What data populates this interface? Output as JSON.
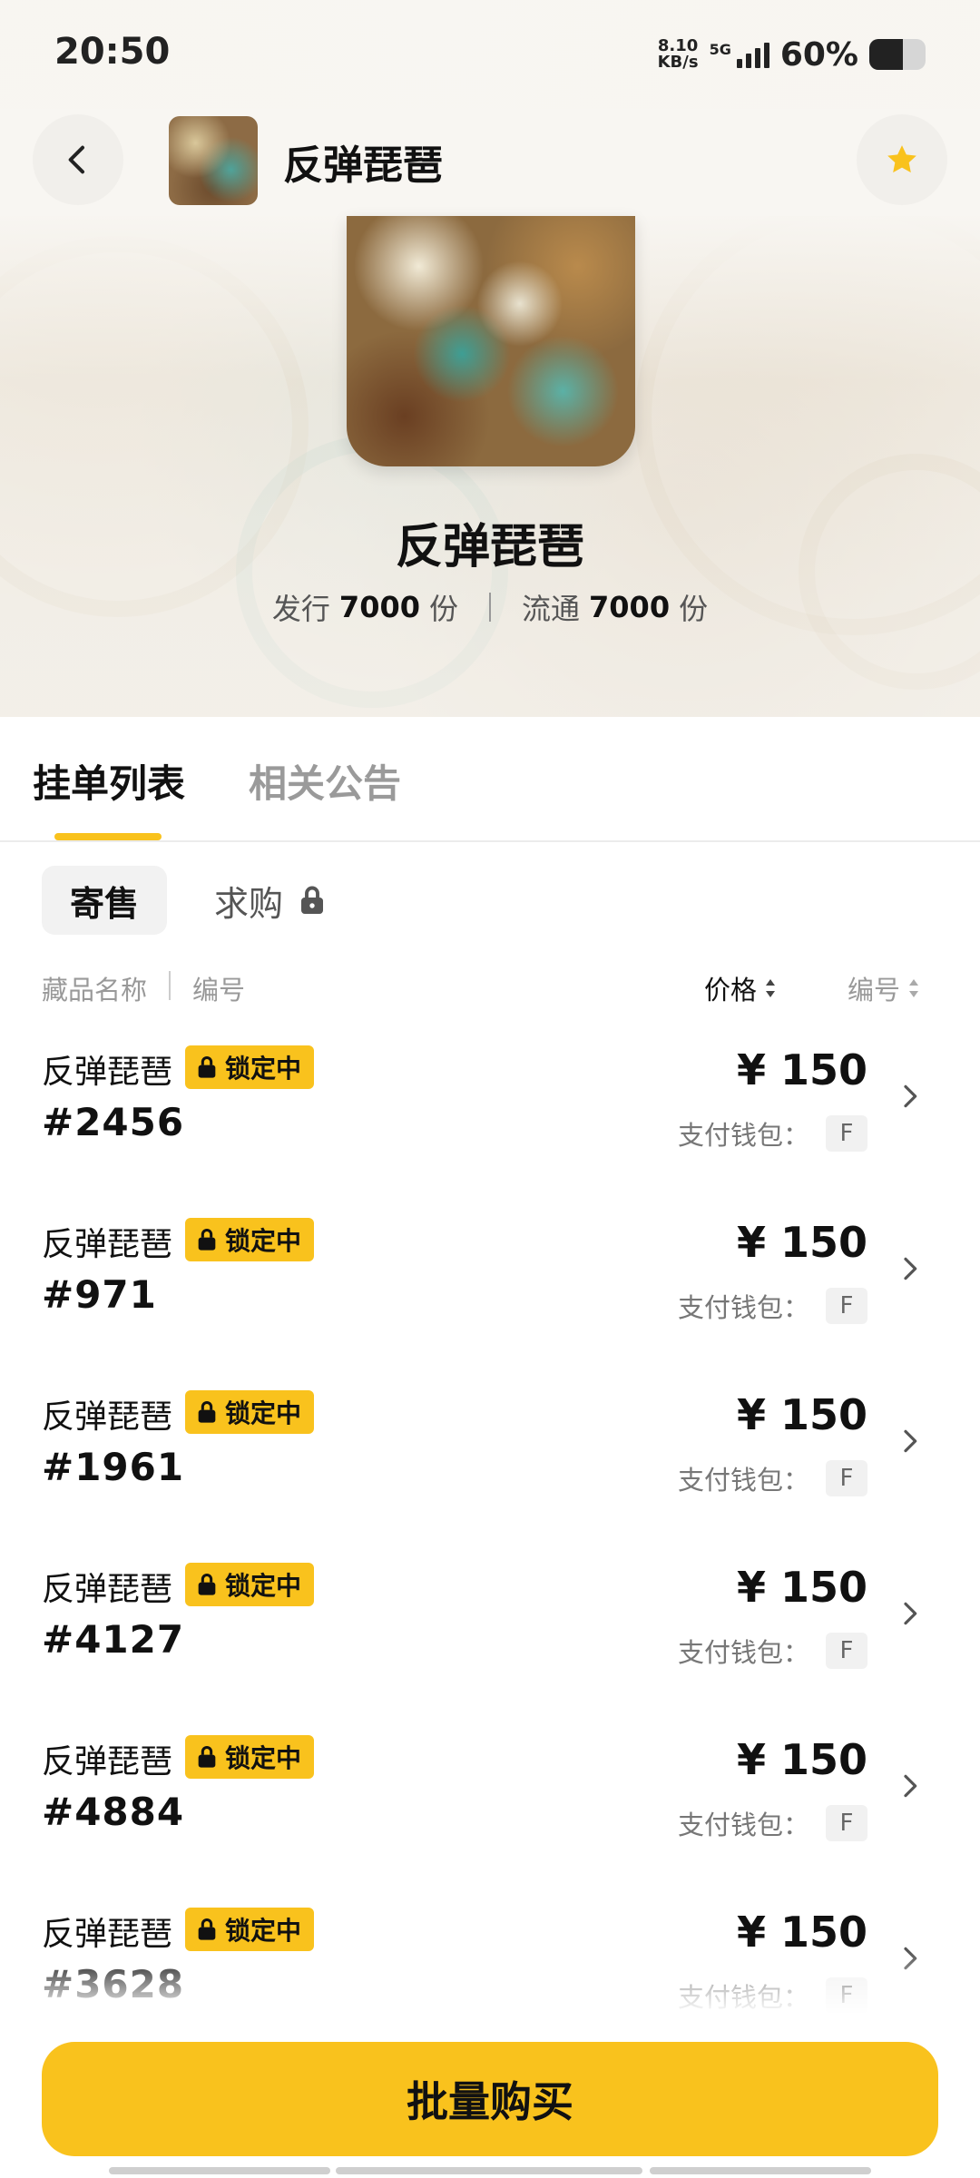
{
  "status_bar": {
    "time": "20:50",
    "net_speed_value": "8.10",
    "net_speed_unit": "KB/s",
    "network": "5G",
    "battery_percent": "60%",
    "battery_level": 0.6
  },
  "header": {
    "title": "反弹琵琶",
    "back_icon": "chevron-left-icon",
    "favorite_icon": "star-icon",
    "favorite_color": "#f9c21d"
  },
  "collection": {
    "title": "反弹琵琶",
    "issued_label": "发行",
    "issued_value": "7000",
    "issued_unit": "份",
    "circulating_label": "流通",
    "circulating_value": "7000",
    "circulating_unit": "份"
  },
  "tabs": {
    "listings": "挂单列表",
    "announcements": "相关公告"
  },
  "subtabs": {
    "sell": "寄售",
    "buy": "求购",
    "buy_icon": "lock-icon"
  },
  "columns": {
    "name": "藏品名称",
    "number": "编号",
    "price": "价格",
    "sort_number": "编号"
  },
  "lock_label": "锁定中",
  "wallet_label": "支付钱包：",
  "items": [
    {
      "name": "反弹琵琶",
      "number": "#2456",
      "price": "¥ 150",
      "wallet": "F"
    },
    {
      "name": "反弹琵琶",
      "number": "#971",
      "price": "¥ 150",
      "wallet": "F"
    },
    {
      "name": "反弹琵琶",
      "number": "#1961",
      "price": "¥ 150",
      "wallet": "F"
    },
    {
      "name": "反弹琵琶",
      "number": "#4127",
      "price": "¥ 150",
      "wallet": "F"
    },
    {
      "name": "反弹琵琶",
      "number": "#4884",
      "price": "¥ 150",
      "wallet": "F"
    },
    {
      "name": "反弹琵琶",
      "number": "#3628",
      "price": "¥ 150",
      "wallet": "F"
    }
  ],
  "bulk_buy_label": "批量购买",
  "colors": {
    "accent": "#f9c21d",
    "text": "#111111",
    "muted": "#999999"
  }
}
